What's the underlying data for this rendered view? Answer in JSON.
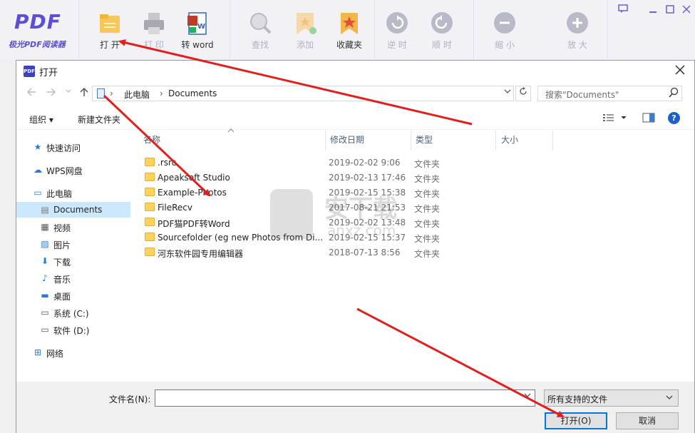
{
  "app": {
    "logo_text": "PDF",
    "app_name": "极光PDF阅读器",
    "toolbar": [
      {
        "label": "打 开",
        "icon": "folder-icon",
        "enabled": true
      },
      {
        "label": "打 印",
        "icon": "printer-icon",
        "enabled": false
      },
      {
        "label": "转 word",
        "icon": "word-convert-icon",
        "enabled": true
      },
      {
        "label": "查找",
        "icon": "search-icon",
        "enabled": false
      },
      {
        "label": "添加",
        "icon": "bookmark-add-icon",
        "enabled": false
      },
      {
        "label": "收藏夹",
        "icon": "bookmark-icon",
        "enabled": true
      },
      {
        "label": "逆 时",
        "icon": "rotate-ccw-icon",
        "enabled": false
      },
      {
        "label": "顺 时",
        "icon": "rotate-cw-icon",
        "enabled": false
      },
      {
        "label": "缩 小",
        "icon": "zoom-out-icon",
        "enabled": false
      },
      {
        "label": "放 大",
        "icon": "zoom-in-icon",
        "enabled": false
      }
    ],
    "brand_color": "#5b4fd6"
  },
  "dialog": {
    "title": "打开",
    "address": {
      "segments": [
        "此电脑",
        "Documents"
      ]
    },
    "search_placeholder": "搜索\"Documents\"",
    "organize_label": "组织 ▾",
    "new_folder_label": "新建文件夹",
    "nav_items": [
      {
        "label": "快速访问",
        "icon": "star-icon"
      },
      {
        "label": "WPS网盘",
        "icon": "cloud-icon"
      },
      {
        "label": "此电脑",
        "icon": "computer-icon"
      },
      {
        "label": "Documents",
        "icon": "documents-icon",
        "selected": true
      },
      {
        "label": "视频",
        "icon": "video-icon"
      },
      {
        "label": "图片",
        "icon": "pictures-icon"
      },
      {
        "label": "下载",
        "icon": "download-icon"
      },
      {
        "label": "音乐",
        "icon": "music-icon"
      },
      {
        "label": "桌面",
        "icon": "desktop-icon"
      },
      {
        "label": "系统 (C:)",
        "icon": "drive-icon"
      },
      {
        "label": "软件 (D:)",
        "icon": "drive-icon"
      },
      {
        "label": "网络",
        "icon": "network-icon"
      }
    ],
    "columns": [
      "名称",
      "修改日期",
      "类型",
      "大小"
    ],
    "files": [
      {
        "name": ".rsrc",
        "date": "2019-02-02 9:06",
        "type": "文件夹"
      },
      {
        "name": "Apeaksoft Studio",
        "date": "2019-02-13 17:46",
        "type": "文件夹"
      },
      {
        "name": "Example-Photos",
        "date": "2019-02-15 15:38",
        "type": "文件夹"
      },
      {
        "name": "FileRecv",
        "date": "2017-08-21 21:53",
        "type": "文件夹"
      },
      {
        "name": "PDF猫PDF转Word",
        "date": "2019-02-02 13:48",
        "type": "文件夹"
      },
      {
        "name": "Sourcefolder (eg new Photos from Di...",
        "date": "2019-02-15 15:37",
        "type": "文件夹"
      },
      {
        "name": "河东软件园专用编辑器",
        "date": "2018-07-13 8:56",
        "type": "文件夹"
      }
    ],
    "filename_label": "文件名(N):",
    "filename_value": "",
    "filter_value": "所有支持的文件",
    "open_label": "打开(O)",
    "cancel_label": "取消"
  },
  "watermark": {
    "text1": "安下载",
    "text2": "anxz.com"
  },
  "annotation_color": "#e02020"
}
